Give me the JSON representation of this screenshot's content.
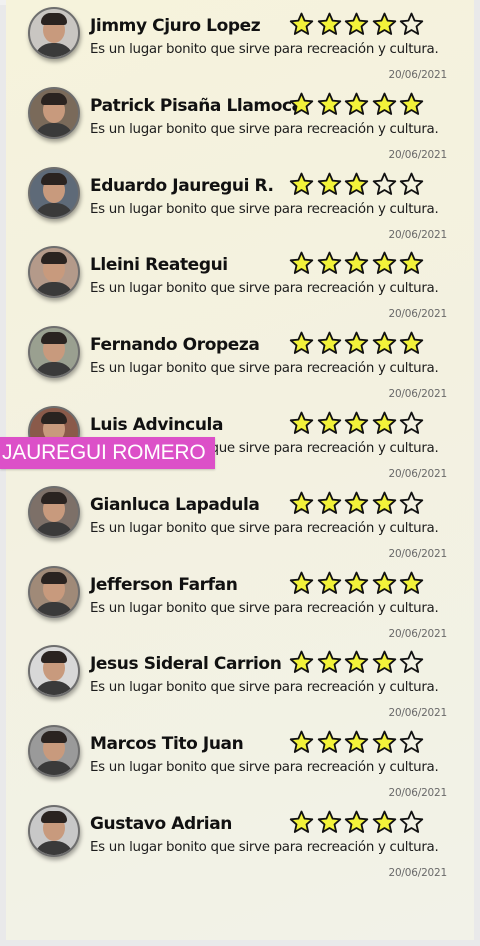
{
  "reviews": [
    {
      "name": "Jimmy Cjuro Lopez",
      "rating": 4,
      "comment": "Es un lugar bonito que sirve para recreación y cultura.",
      "date": "20/06/2021"
    },
    {
      "name": "Patrick Pisaña Llamoca",
      "rating": 5,
      "comment": "Es un lugar bonito que sirve para recreación y cultura.",
      "date": "20/06/2021"
    },
    {
      "name": "Eduardo Jauregui R.",
      "rating": 3,
      "comment": "Es un lugar bonito que sirve para recreación y cultura.",
      "date": "20/06/2021"
    },
    {
      "name": "Lleini Reategui",
      "rating": 5,
      "comment": "Es un lugar bonito que sirve para recreación y cultura.",
      "date": "20/06/2021"
    },
    {
      "name": "Fernando Oropeza",
      "rating": 5,
      "comment": "Es un lugar bonito que sirve para recreación y cultura.",
      "date": "20/06/2021"
    },
    {
      "name": "Luis Advincula",
      "rating": 4,
      "comment": "Es un lugar bonito que sirve para recreación y cultura.",
      "date": "20/06/2021"
    },
    {
      "name": "Gianluca Lapadula",
      "rating": 4,
      "comment": "Es un lugar bonito que sirve para recreación y cultura.",
      "date": "20/06/2021"
    },
    {
      "name": "Jefferson Farfan",
      "rating": 5,
      "comment": "Es un lugar bonito que sirve para recreación y cultura.",
      "date": "20/06/2021"
    },
    {
      "name": "Jesus Sideral Carrion",
      "rating": 4,
      "comment": "Es un lugar bonito que sirve para recreación y cultura.",
      "date": "20/06/2021"
    },
    {
      "name": "Marcos Tito Juan",
      "rating": 4,
      "comment": "Es un lugar bonito que sirve para recreación y cultura.",
      "date": "20/06/2021"
    },
    {
      "name": "Gustavo Adrian",
      "rating": 4,
      "comment": "Es un lugar bonito que sirve para recreación y cultura.",
      "date": "20/06/2021"
    }
  ],
  "overlay_label": "JAUREGUI ROMERO",
  "colors": {
    "star_fill": "#f2f23a",
    "star_outline": "#111111",
    "overlay_bg": "#dc50c8"
  }
}
